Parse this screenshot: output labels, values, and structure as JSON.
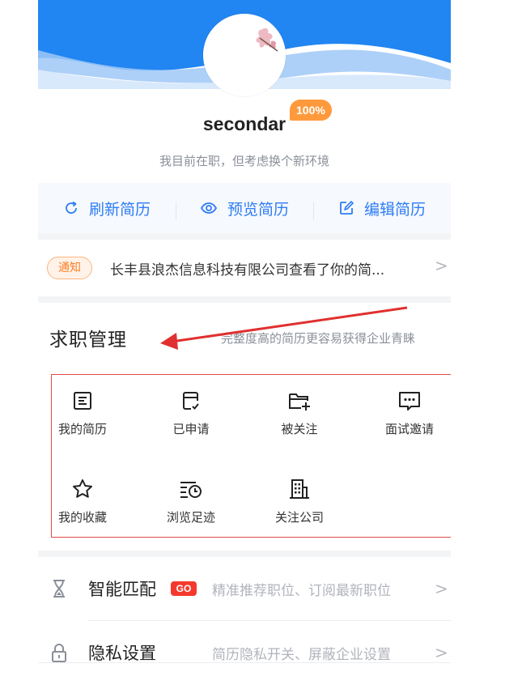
{
  "profile": {
    "username": "secondar",
    "completeness_badge": "100%",
    "status": "我目前在职，但考虑换个新环境"
  },
  "actions": [
    {
      "label": "刷新简历",
      "icon": "refresh-icon"
    },
    {
      "label": "预览简历",
      "icon": "eye-icon"
    },
    {
      "label": "编辑简历",
      "icon": "edit-icon"
    }
  ],
  "notice": {
    "tag": "通知",
    "text": "长丰县浪杰信息科技有限公司查看了你的简...",
    "chevron": ">"
  },
  "job_management": {
    "title": "求职管理",
    "subtitle": "完整度高的简历更容易获得企业青睐",
    "items": [
      {
        "label": "我的简历",
        "icon": "resume-icon"
      },
      {
        "label": "已申请",
        "icon": "applied-icon"
      },
      {
        "label": "被关注",
        "icon": "folder-add-icon"
      },
      {
        "label": "面试邀请",
        "icon": "message-icon"
      },
      {
        "label": "我的收藏",
        "icon": "star-icon"
      },
      {
        "label": "浏览足迹",
        "icon": "history-icon"
      },
      {
        "label": "关注公司",
        "icon": "building-icon"
      }
    ]
  },
  "menu": [
    {
      "title": "智能匹配",
      "badge": "GO",
      "subtitle": "精准推荐职位、订阅最新职位",
      "icon": "hourglass-icon",
      "chevron": ">"
    },
    {
      "title": "隐私设置",
      "subtitle": "简历隐私开关、屏蔽企业设置",
      "icon": "lock-icon",
      "chevron": ">"
    }
  ],
  "colors": {
    "brand_blue": "#2e7cf6",
    "header_blue": "#1a82f0",
    "badge_orange": "#ff9a3c",
    "annotation_red": "#e0302f",
    "go_red": "#f43a2e"
  }
}
